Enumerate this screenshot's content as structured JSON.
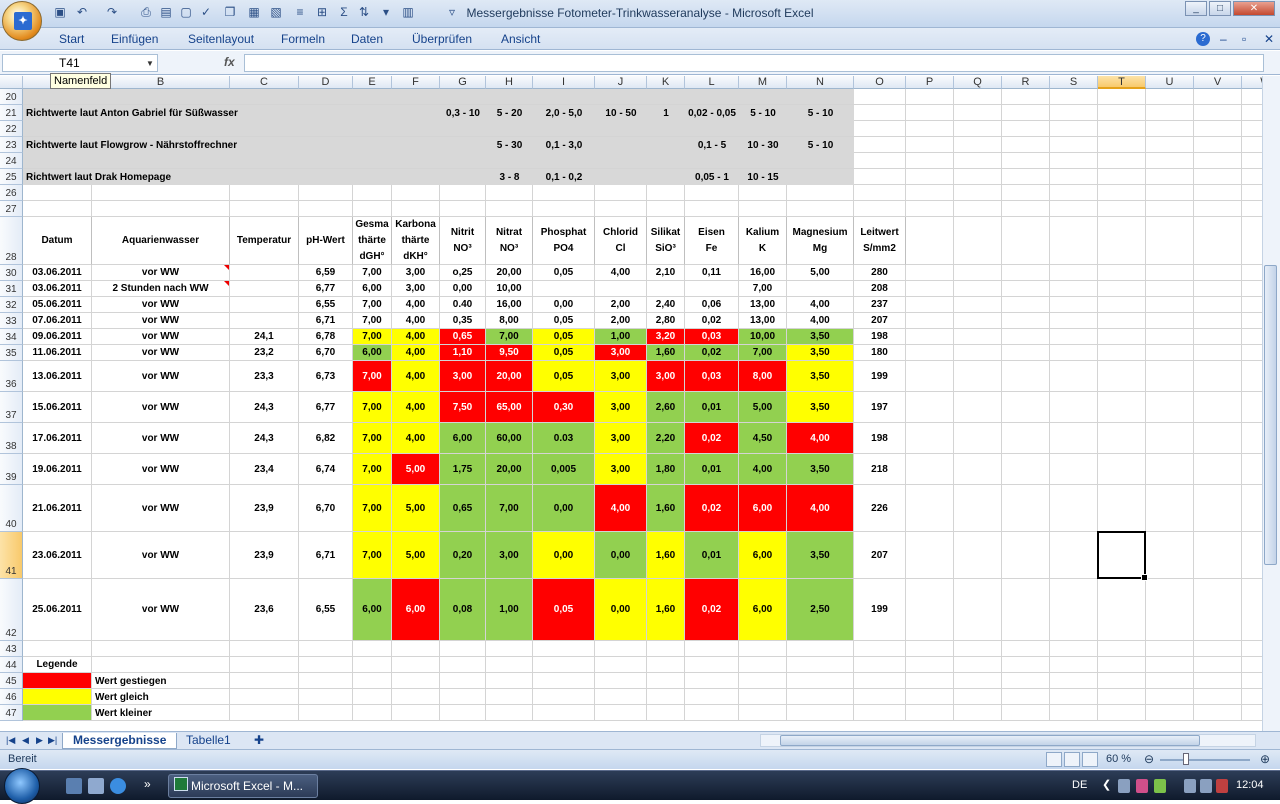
{
  "app_title": "Messergebnisse Fotometer-Trinkwasseranalyse - Microsoft Excel",
  "ribbon_tabs": [
    "Start",
    "Einfügen",
    "Seitenlayout",
    "Formeln",
    "Daten",
    "Überprüfen",
    "Ansicht"
  ],
  "formula_bar": {
    "name_box": "T41",
    "tooltip": "Namenfeld",
    "fx": "fx",
    "value": ""
  },
  "columns": [
    "A",
    "B",
    "C",
    "D",
    "E",
    "F",
    "G",
    "H",
    "I",
    "J",
    "K",
    "L",
    "M",
    "N",
    "O",
    "P",
    "Q",
    "R",
    "S",
    "T",
    "U",
    "V",
    "W"
  ],
  "selected_column": "T",
  "selected_row": "41",
  "rows": [
    "20",
    "21",
    "22",
    "23",
    "24",
    "25",
    "26",
    "27",
    "28",
    "30",
    "31",
    "32",
    "33",
    "34",
    "35",
    "36",
    "37",
    "38",
    "39",
    "40",
    "41",
    "42",
    "43",
    "44",
    "45",
    "46",
    "47"
  ],
  "reference_rows": [
    {
      "label": "Richtwerte laut Anton Gabriel für Süßwasser",
      "G": "0,3 - 10",
      "H": "5 - 20",
      "I": "2,0 - 5,0",
      "J": "10 - 50",
      "K": "1",
      "L": "0,02 - 0,05",
      "M": "5 - 10",
      "N": "5 - 10"
    },
    {
      "label": "Richtwerte laut Flowgrow - Nährstoffrechner",
      "G": "",
      "H": "5 - 30",
      "I": "0,1 - 3,0",
      "J": "",
      "K": "",
      "L": "0,1 - 5",
      "M": "10 - 30",
      "N": "5 - 10"
    },
    {
      "label": "Richtwert laut Drak Homepage",
      "G": "",
      "H": "3 - 8",
      "I": "0,1 - 0,2",
      "J": "",
      "K": "",
      "L": "0,05 - 1",
      "M": "10 - 15",
      "N": ""
    }
  ],
  "headers": [
    "Datum",
    "Aquarienwasser",
    "Temperatur",
    "pH-Wert",
    "Gesmaţhärte dGH°",
    "Karbonaţhärte dKH°",
    "Nitrit NO³",
    "Nitrat NO³",
    "Phosphat PO4",
    "Chlorid Cl",
    "Silikat SiO³",
    "Eisen Fe",
    "Kalium K",
    "Magnesium Mg",
    "Leitwert S/mm2"
  ],
  "header_cells": [
    [
      "Datum"
    ],
    [
      "Aquarienwasser"
    ],
    [
      "Temperatur"
    ],
    [
      "pH-Wert"
    ],
    [
      "Gesma",
      "thärte",
      "dGH°"
    ],
    [
      "Karbona",
      "thärte",
      "dKH°"
    ],
    [
      "Nitrit",
      "NO³"
    ],
    [
      "Nitrat",
      "NO³"
    ],
    [
      "Phosphat",
      "PO4"
    ],
    [
      "Chlorid",
      "Cl"
    ],
    [
      "Silikat",
      "SiO³"
    ],
    [
      "Eisen",
      "Fe"
    ],
    [
      "Kalium",
      "K"
    ],
    [
      "Magnesium",
      "Mg"
    ],
    [
      "Leitwert",
      "S/mm2"
    ]
  ],
  "data_rows": [
    {
      "row": "30",
      "cells": [
        "03.06.2011",
        "vor WW",
        "",
        "6,59",
        "7,00",
        "3,00",
        "o,25",
        "20,00",
        "0,05",
        "4,00",
        "2,10",
        "0,11",
        "16,00",
        "5,00",
        "280"
      ],
      "colors": [
        "",
        "",
        "",
        "",
        "",
        "",
        "",
        "",
        "",
        "",
        "",
        "",
        "",
        "",
        ""
      ]
    },
    {
      "row": "31",
      "cells": [
        "03.06.2011",
        "2 Stunden nach WW",
        "",
        "6,77",
        "6,00",
        "3,00",
        "0,00",
        "10,00",
        "",
        "",
        "",
        "",
        "7,00",
        "",
        "208"
      ],
      "colors": [
        "",
        "",
        "",
        "",
        "",
        "",
        "",
        "",
        "",
        "",
        "",
        "",
        "",
        "",
        ""
      ]
    },
    {
      "row": "32",
      "cells": [
        "05.06.2011",
        "vor WW",
        "",
        "6,55",
        "7,00",
        "4,00",
        "0.40",
        "16,00",
        "0,00",
        "2,00",
        "2,40",
        "0,06",
        "13,00",
        "4,00",
        "237"
      ],
      "colors": [
        "",
        "",
        "",
        "",
        "",
        "",
        "",
        "",
        "",
        "",
        "",
        "",
        "",
        "",
        ""
      ]
    },
    {
      "row": "33",
      "cells": [
        "07.06.2011",
        "vor WW",
        "",
        "6,71",
        "7,00",
        "4,00",
        "0,35",
        "8,00",
        "0,05",
        "2,00",
        "2,80",
        "0,02",
        "13,00",
        "4,00",
        "207"
      ],
      "colors": [
        "",
        "",
        "",
        "",
        "",
        "",
        "",
        "",
        "",
        "",
        "",
        "",
        "",
        "",
        ""
      ]
    },
    {
      "row": "34",
      "cells": [
        "09.06.2011",
        "vor WW",
        "24,1",
        "6,78",
        "7,00",
        "4,00",
        "0,65",
        "7,00",
        "0,05",
        "1,00",
        "3,20",
        "0,03",
        "10,00",
        "3,50",
        "198"
      ],
      "colors": [
        "",
        "",
        "",
        "",
        "yel",
        "yel",
        "red",
        "grn",
        "yel",
        "grn",
        "red",
        "red",
        "grn",
        "grn",
        ""
      ]
    },
    {
      "row": "35",
      "cells": [
        "11.06.2011",
        "vor WW",
        "23,2",
        "6,70",
        "6,00",
        "4,00",
        "1,10",
        "9,50",
        "0,05",
        "3,00",
        "1,60",
        "0,02",
        "7,00",
        "3,50",
        "180"
      ],
      "colors": [
        "",
        "",
        "",
        "",
        "grn",
        "yel",
        "red",
        "red",
        "yel",
        "red",
        "grn",
        "grn",
        "grn",
        "yel",
        ""
      ]
    },
    {
      "row": "36",
      "cells": [
        "13.06.2011",
        "vor WW",
        "23,3",
        "6,73",
        "7,00",
        "4,00",
        "3,00",
        "20,00",
        "0,05",
        "3,00",
        "3,00",
        "0,03",
        "8,00",
        "3,50",
        "199"
      ],
      "colors": [
        "",
        "",
        "",
        "",
        "red",
        "yel",
        "red",
        "red",
        "yel",
        "yel",
        "red",
        "red",
        "red",
        "yel",
        ""
      ]
    },
    {
      "row": "37",
      "cells": [
        "15.06.2011",
        "vor WW",
        "24,3",
        "6,77",
        "7,00",
        "4,00",
        "7,50",
        "65,00",
        "0,30",
        "3,00",
        "2,60",
        "0,01",
        "5,00",
        "3,50",
        "197"
      ],
      "colors": [
        "",
        "",
        "",
        "",
        "yel",
        "yel",
        "red",
        "red",
        "red",
        "yel",
        "grn",
        "grn",
        "grn",
        "yel",
        ""
      ]
    },
    {
      "row": "38",
      "cells": [
        "17.06.2011",
        "vor WW",
        "24,3",
        "6,82",
        "7,00",
        "4,00",
        "6,00",
        "60,00",
        "0.03",
        "3,00",
        "2,20",
        "0,02",
        "4,50",
        "4,00",
        "198"
      ],
      "colors": [
        "",
        "",
        "",
        "",
        "yel",
        "yel",
        "grn",
        "grn",
        "grn",
        "yel",
        "grn",
        "red",
        "grn",
        "red",
        ""
      ]
    },
    {
      "row": "39",
      "cells": [
        "19.06.2011",
        "vor WW",
        "23,4",
        "6,74",
        "7,00",
        "5,00",
        "1,75",
        "20,00",
        "0,005",
        "3,00",
        "1,80",
        "0,01",
        "4,00",
        "3,50",
        "218"
      ],
      "colors": [
        "",
        "",
        "",
        "",
        "yel",
        "red",
        "grn",
        "grn",
        "grn",
        "yel",
        "grn",
        "grn",
        "grn",
        "grn",
        ""
      ]
    },
    {
      "row": "40",
      "cells": [
        "21.06.2011",
        "vor WW",
        "23,9",
        "6,70",
        "7,00",
        "5,00",
        "0,65",
        "7,00",
        "0,00",
        "4,00",
        "1,60",
        "0,02",
        "6,00",
        "4,00",
        "226"
      ],
      "colors": [
        "",
        "",
        "",
        "",
        "yel",
        "yel",
        "grn",
        "grn",
        "grn",
        "red",
        "grn",
        "red",
        "red",
        "red",
        ""
      ]
    },
    {
      "row": "41",
      "cells": [
        "23.06.2011",
        "vor WW",
        "23,9",
        "6,71",
        "7,00",
        "5,00",
        "0,20",
        "3,00",
        "0,00",
        "0,00",
        "1,60",
        "0,01",
        "6,00",
        "3,50",
        "207"
      ],
      "colors": [
        "",
        "",
        "",
        "",
        "yel",
        "yel",
        "grn",
        "grn",
        "yel",
        "grn",
        "yel",
        "grn",
        "yel",
        "grn",
        ""
      ]
    },
    {
      "row": "42",
      "cells": [
        "25.06.2011",
        "vor WW",
        "23,6",
        "6,55",
        "6,00",
        "6,00",
        "0,08",
        "1,00",
        "0,05",
        "0,00",
        "1,60",
        "0,02",
        "6,00",
        "2,50",
        "199"
      ],
      "colors": [
        "",
        "",
        "",
        "",
        "grn",
        "red",
        "grn",
        "grn",
        "red",
        "yel",
        "yel",
        "red",
        "yel",
        "grn",
        ""
      ]
    }
  ],
  "legend": {
    "title": "Legende",
    "items": [
      {
        "color": "red",
        "label": "Wert gestiegen"
      },
      {
        "color": "yel",
        "label": "Wert gleich"
      },
      {
        "color": "grn",
        "label": "Wert kleiner"
      }
    ]
  },
  "sheet_tabs": [
    "Messergebnisse",
    "Tabelle1"
  ],
  "active_sheet": "Messergebnisse",
  "status": {
    "ready": "Bereit",
    "zoom": "60 %"
  },
  "taskbar": {
    "window": "Microsoft Excel - M...",
    "language": "DE",
    "clock": "12:04"
  },
  "colors": {
    "red": "#ff0000",
    "yel": "#ffff00",
    "grn": "#92d050",
    "grey": "#d8d8d8",
    "accent": "#15428b"
  }
}
